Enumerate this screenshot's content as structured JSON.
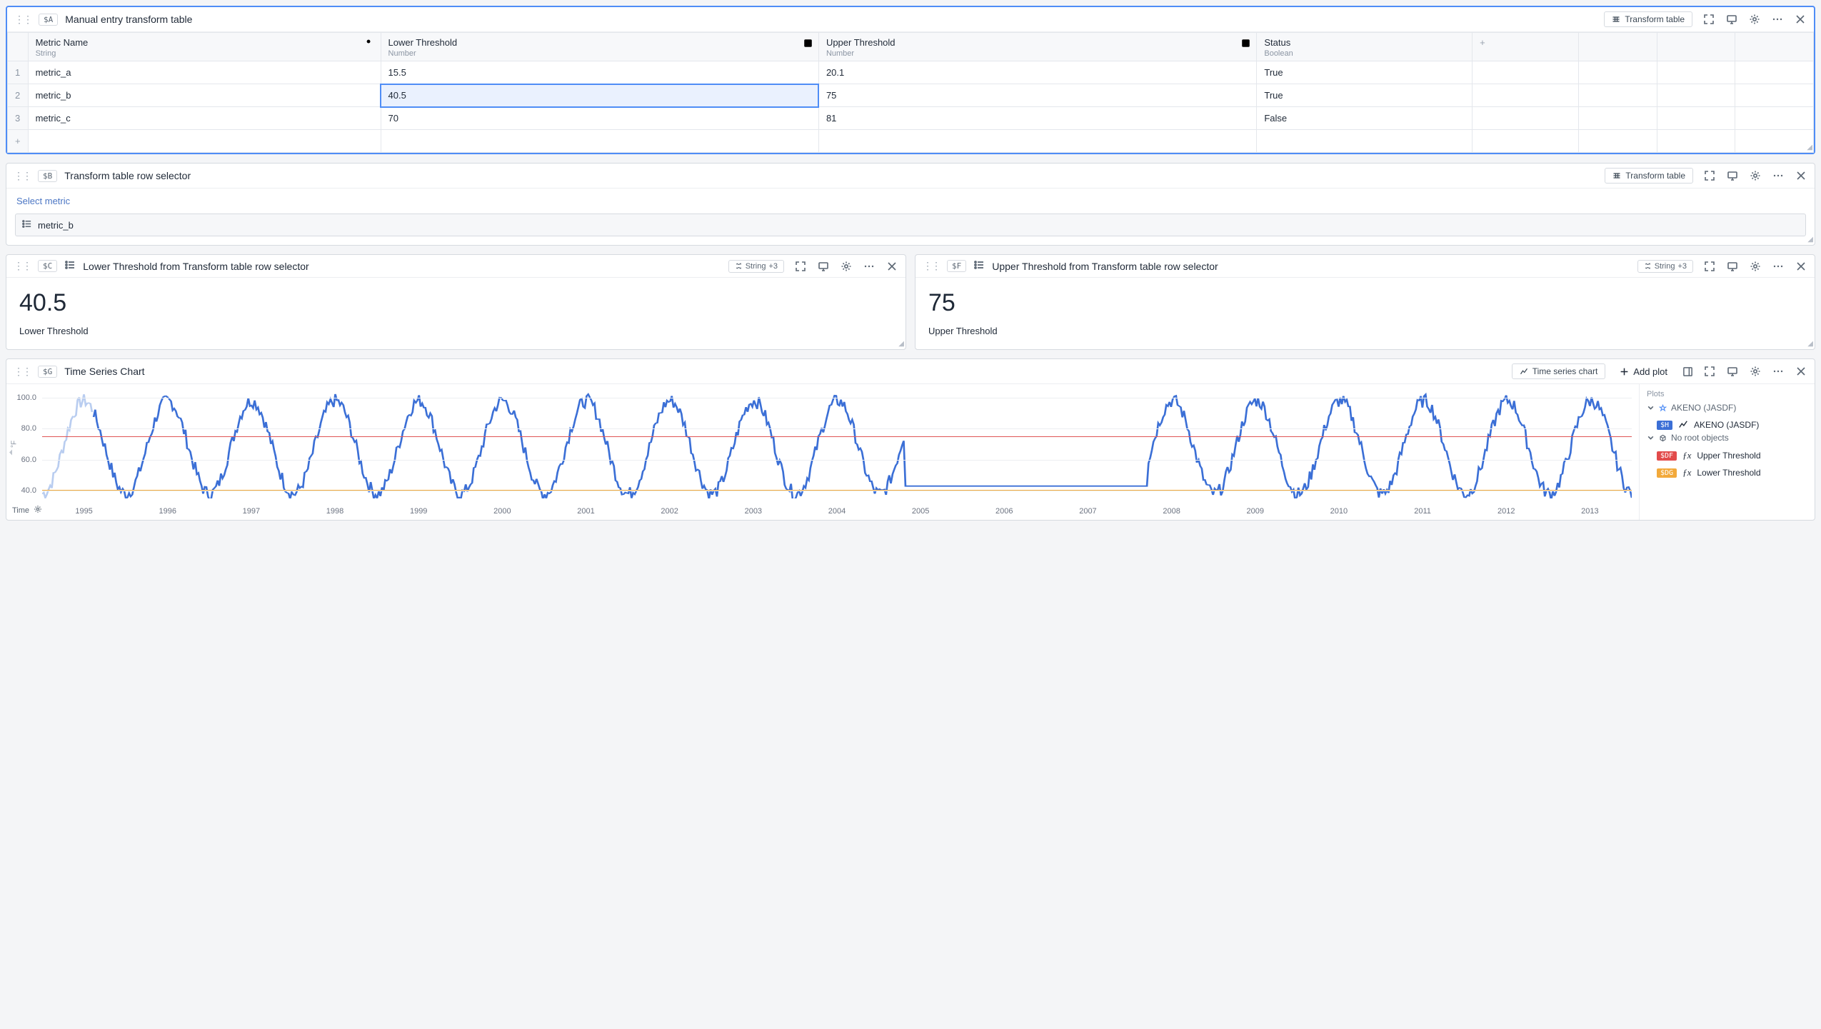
{
  "cardA": {
    "var": "$A",
    "title": "Manual entry transform table",
    "transform_btn": "Transform table",
    "columns": [
      {
        "name": "Metric Name",
        "type": "String",
        "icon": "key"
      },
      {
        "name": "Lower Threshold",
        "type": "Number",
        "icon": "dropdown"
      },
      {
        "name": "Upper Threshold",
        "type": "Number",
        "icon": "dropdown"
      },
      {
        "name": "Status",
        "type": "Boolean",
        "icon": ""
      }
    ],
    "rows": [
      {
        "n": "1",
        "cells": [
          "metric_a",
          "15.5",
          "20.1",
          "True"
        ]
      },
      {
        "n": "2",
        "cells": [
          "metric_b",
          "40.5",
          "75",
          "True"
        ]
      },
      {
        "n": "3",
        "cells": [
          "metric_c",
          "70",
          "81",
          "False"
        ]
      }
    ],
    "selected_cell": {
      "row": 1,
      "col": 1
    }
  },
  "cardB": {
    "var": "$B",
    "title": "Transform table row selector",
    "transform_btn": "Transform table",
    "section_label": "Select metric",
    "selected_value": "metric_b"
  },
  "cardC": {
    "var": "$C",
    "title": "Lower Threshold from Transform table row selector",
    "type_label": "String",
    "type_extra": "+3",
    "value": "40.5",
    "label": "Lower Threshold"
  },
  "cardF": {
    "var": "$F",
    "title": "Upper Threshold from Transform table row selector",
    "type_label": "String",
    "type_extra": "+3",
    "value": "75",
    "label": "Upper Threshold"
  },
  "cardG": {
    "var": "$G",
    "title": "Time Series Chart",
    "chart_type_btn": "Time series chart",
    "add_plot": "Add plot",
    "time_label": "Time",
    "plots_panel": {
      "title": "Plots",
      "group1": "AKENO (JASDF)",
      "item1_badge": "$H",
      "item1_label": "AKENO (JASDF)",
      "group2": "No root objects",
      "item2_badge": "$DF",
      "item2_label": "Upper Threshold",
      "item3_badge": "$DG",
      "item3_label": "Lower Threshold"
    }
  },
  "chart_data": {
    "type": "line",
    "title": "Time Series Chart",
    "ylabel": "°F",
    "xlabel": "Time",
    "ylim": [
      35,
      105
    ],
    "y_ticks": [
      40.0,
      60.0,
      80.0,
      100.0
    ],
    "x_ticks": [
      "1995",
      "1996",
      "1997",
      "1998",
      "1999",
      "2000",
      "2001",
      "2002",
      "2003",
      "2004",
      "2005",
      "2006",
      "2007",
      "2008",
      "2009",
      "2010",
      "2011",
      "2012",
      "2013"
    ],
    "reference_lines": [
      {
        "name": "Upper Threshold",
        "value": 75,
        "color": "#e05555"
      },
      {
        "name": "Lower Threshold",
        "value": 40.5,
        "color": "#f2a93b"
      }
    ],
    "series": [
      {
        "name": "AKENO (JASDF)",
        "note": "Approximate seasonal daily temperature cycle; flat segment 2005-2008 indicates missing data near 43°F.",
        "approx_annual_min": 38,
        "approx_annual_max": 98,
        "missing_range": [
          "2005",
          "2008"
        ]
      }
    ]
  }
}
